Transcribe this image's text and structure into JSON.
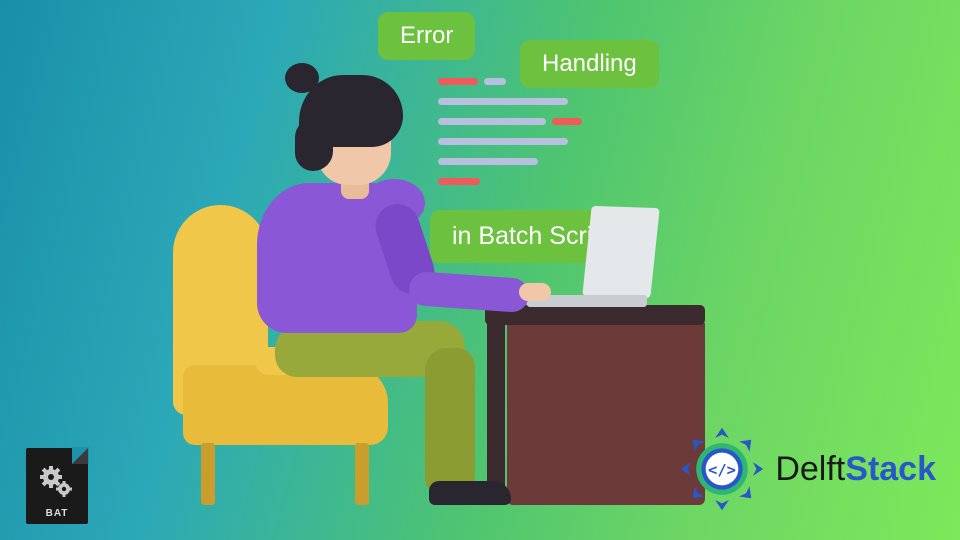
{
  "pills": {
    "error": "Error",
    "handling": "Handling",
    "batch": "in Batch Script"
  },
  "batIcon": {
    "label": "BAT"
  },
  "logo": {
    "part1": "Delft",
    "part2": "Stack"
  }
}
